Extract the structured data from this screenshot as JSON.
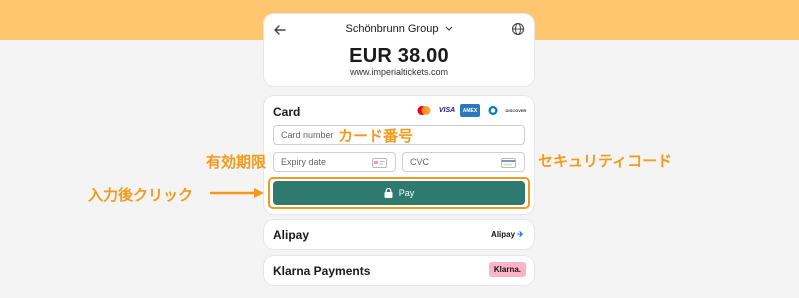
{
  "header": {
    "merchant": "Schönbrunn Group",
    "amount": "EUR 38.00",
    "site": "www.imperialtickets.com"
  },
  "card": {
    "title": "Card",
    "brands": [
      "mastercard",
      "VISA",
      "AMEX",
      "Diners Club",
      "DISCOVER"
    ],
    "number_placeholder": "Card number",
    "expiry_placeholder": "Expiry date",
    "cvc_placeholder": "CVC",
    "pay_label": "Pay"
  },
  "methods": {
    "alipay_label": "Alipay",
    "alipay_logo": "Alipay",
    "klarna_label": "Klarna Payments",
    "klarna_logo": "Klarna."
  },
  "annotations": {
    "card_number": "カード番号",
    "expiry": "有効期限",
    "cvc": "セキュリティコード",
    "click": "入力後クリック"
  },
  "colors": {
    "top_band": "#fec76f",
    "annotation": "#f39a1b",
    "pay_button": "#2e7a6f"
  }
}
